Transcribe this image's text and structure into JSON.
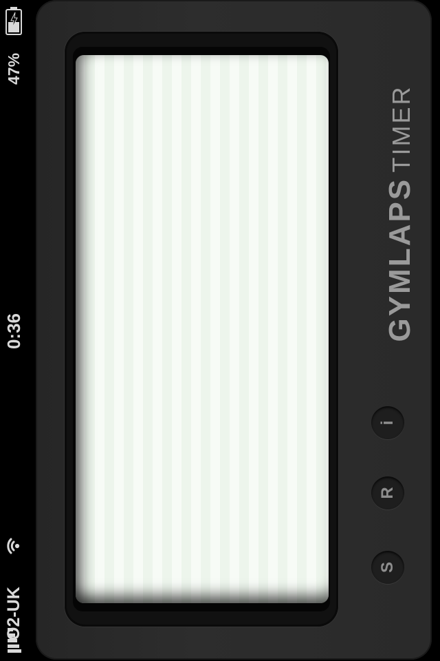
{
  "status_bar": {
    "carrier": "O2-UK",
    "time": "0:36",
    "battery_percent": "47%",
    "signal_icon": "signal-bars-icon",
    "wifi_icon": "wifi-icon",
    "battery_icon": "battery-charging-icon"
  },
  "brand": {
    "primary": "GYMLAPS",
    "secondary": "TIMER"
  },
  "buttons": {
    "info_label": "i",
    "reset_label": "R",
    "start_label": "S"
  },
  "colors": {
    "device_body": "#2a2a2a",
    "display_background": "#f7fbf6",
    "brand_text": "#9a9a9a"
  }
}
